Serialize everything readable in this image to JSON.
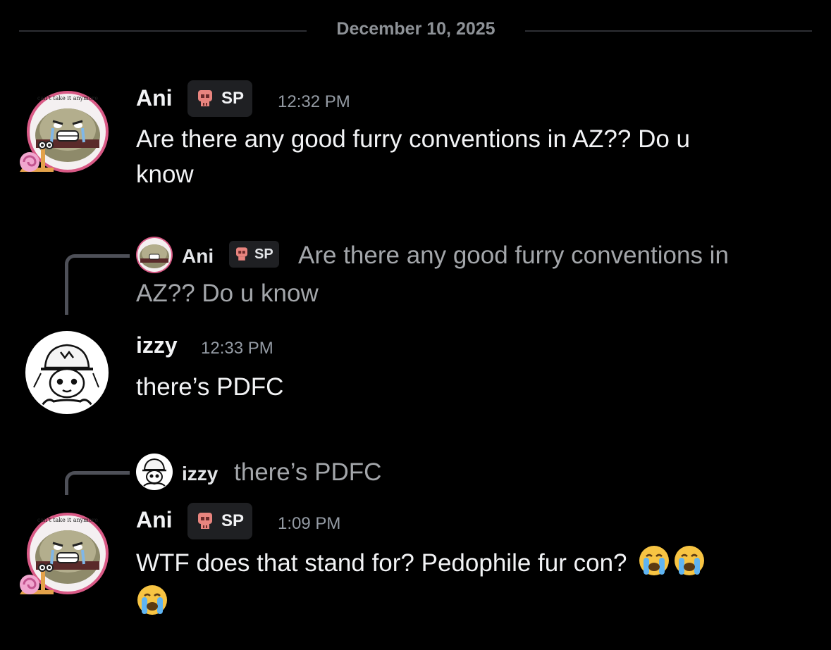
{
  "divider": {
    "date": "December 10, 2025"
  },
  "messages": [
    {
      "author": "Ani",
      "tag": "SP",
      "time": "12:32 PM",
      "text_line1": "Are there any good furry conventions in AZ?? Do u",
      "text_line2": "know",
      "avatar_caption": "can't take it anymore"
    },
    {
      "reply": {
        "author": "Ani",
        "tag": "SP",
        "text_line1": "Are there any good furry conventions in",
        "text_line2": "AZ?? Do u know"
      },
      "author": "izzy",
      "time": "12:33 PM",
      "text": "there’s PDFC"
    },
    {
      "reply": {
        "author": "izzy",
        "text": "there’s PDFC"
      },
      "author": "Ani",
      "tag": "SP",
      "time": "1:09 PM",
      "text_line1": "WTF does that stand for? Pedophile fur con?",
      "emoji_name": "loudly-crying-face-emoji",
      "avatar_caption": "can't take it anymore"
    }
  ],
  "colors": {
    "background": "#000000",
    "username": "#f2f3f5",
    "timestamp": "#949ba4",
    "reply_text": "#a3a6aa",
    "tag_bg": "#1f2023",
    "skull": "#e8847e"
  }
}
